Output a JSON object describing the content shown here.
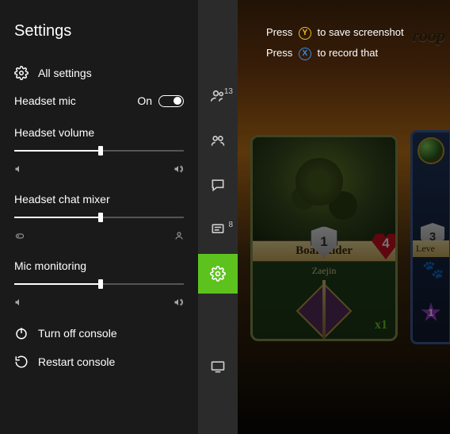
{
  "settings": {
    "title": "Settings",
    "all_settings": "All settings",
    "headset_mic": {
      "label": "Headset mic",
      "state_label": "On",
      "on": true
    },
    "headset_volume": {
      "label": "Headset volume",
      "value": 51
    },
    "chat_mixer": {
      "label": "Headset chat mixer",
      "value": 51
    },
    "mic_monitoring": {
      "label": "Mic monitoring",
      "value": 51
    },
    "turn_off": "Turn off console",
    "restart": "Restart console",
    "icons": {
      "vol_low": "volume-low-icon",
      "vol_high": "volume-high-icon",
      "game": "controller-icon",
      "person": "person-icon"
    }
  },
  "rail": {
    "items": [
      {
        "name": "friends",
        "badge": "13"
      },
      {
        "name": "party",
        "badge": null
      },
      {
        "name": "messages",
        "badge": null
      },
      {
        "name": "notifications",
        "badge": "8"
      },
      {
        "name": "settings",
        "badge": null,
        "active": true
      }
    ],
    "bottom": {
      "name": "tv"
    }
  },
  "overlay": {
    "press": "Press",
    "save_screenshot": "to save screenshot",
    "record_that": "to record that",
    "y": "Y",
    "x": "X"
  },
  "game": {
    "banner": "roop",
    "card": {
      "name": "Boar Rider",
      "subtitle": "Zaejin",
      "armor": "1",
      "health": "4",
      "multiplier": "x1"
    },
    "side_card": {
      "armor": "3",
      "name_fragment": "Leve",
      "star": "1"
    }
  }
}
